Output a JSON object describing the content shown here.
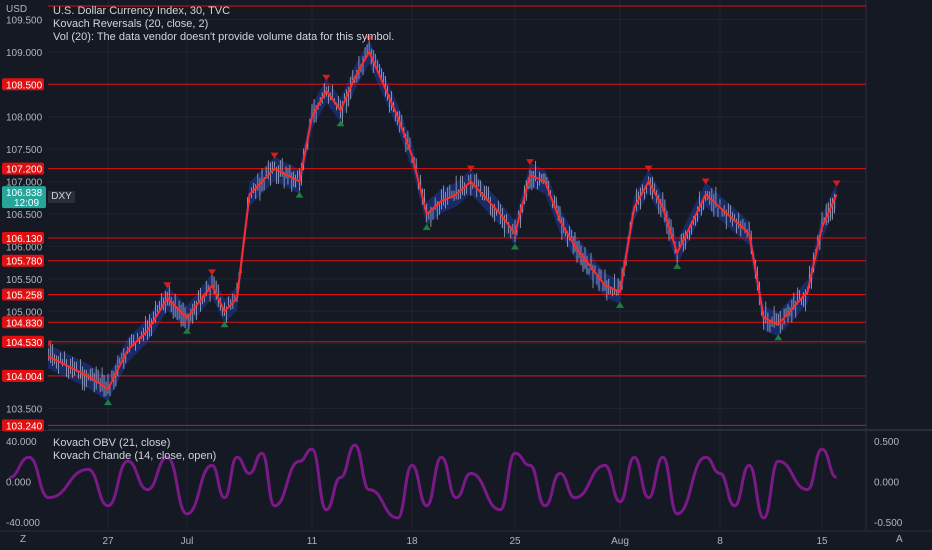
{
  "colors": {
    "background": "#151924",
    "grid": "#1f2431",
    "sr_line": "#e01010",
    "price_line": "#ff2a2a",
    "band": "#1e3a9c",
    "candle": "#d0d4dc",
    "down_marker": "#d61b1b",
    "up_marker": "#19803d",
    "oscillator": "#7a1a86",
    "price_tag": "#26a69a"
  },
  "legend": {
    "line1": "U.S. Dollar Currency Index, 30, TVC",
    "line2": "Kovach Reversals (20, close, 2)",
    "line3": "Vol (20): The data vendor doesn't provide volume data for this symbol."
  },
  "indicator_legend": {
    "line1": "Kovach OBV (21, close)",
    "line2": "Kovach Chande (14, close, open)"
  },
  "corner": {
    "currency": "USD",
    "left_scale_btn": "Z",
    "right_scale_btn": "A"
  },
  "current_price": {
    "value": "106.838",
    "countdown": "12:09",
    "symbol": "DXY"
  },
  "chart_data": [
    {
      "type": "line",
      "title": "U.S. Dollar Currency Index, 30, TVC",
      "ylabel": "USD",
      "ylim": [
        103.2,
        109.8
      ],
      "x_ticks": [
        "27",
        "Jul",
        "11",
        "18",
        "25",
        "Aug",
        "8",
        "15"
      ],
      "y_ticks": [
        "103.500",
        "104.000",
        "104.500",
        "105.000",
        "105.500",
        "106.000",
        "106.500",
        "107.000",
        "107.500",
        "108.000",
        "108.500",
        "109.000",
        "109.500"
      ],
      "levels": [
        "108.500",
        "107.200",
        "106.130",
        "105.780",
        "105.258",
        "104.830",
        "104.530",
        "104.004",
        "103.240"
      ],
      "last_price": 106.838,
      "series": [
        {
          "x": [
            "Jun 22",
            "Jun 23",
            "Jun 24",
            "Jun 26",
            "Jun 27",
            "Jun 28",
            "Jun 29",
            "Jun 30",
            "Jul 1",
            "Jul 3",
            "Jul 4",
            "Jul 5",
            "Jul 6",
            "Jul 7",
            "Jul 8",
            "Jul 10",
            "Jul 11",
            "Jul 12",
            "Jul 13",
            "Jul 14",
            "Jul 15",
            "Jul 17",
            "Jul 18",
            "Jul 19",
            "Jul 20",
            "Jul 21",
            "Jul 22",
            "Jul 24",
            "Jul 25",
            "Jul 26",
            "Jul 27",
            "Jul 28",
            "Jul 29",
            "Jul 31",
            "Aug 1",
            "Aug 2",
            "Aug 3",
            "Aug 4",
            "Aug 5",
            "Aug 7",
            "Aug 8",
            "Aug 9",
            "Aug 10",
            "Aug 11",
            "Aug 12",
            "Aug 14",
            "Aug 15",
            "Aug 16"
          ],
          "y": [
            104.8,
            104.3,
            104.3,
            104.0,
            103.8,
            104.4,
            104.7,
            105.2,
            104.9,
            105.4,
            105.0,
            105.2,
            106.8,
            107.0,
            107.2,
            107.0,
            108.0,
            108.4,
            108.1,
            108.6,
            109.0,
            108.0,
            107.4,
            106.5,
            106.7,
            106.8,
            107.0,
            106.5,
            106.2,
            107.1,
            107.0,
            106.4,
            106.0,
            105.4,
            105.3,
            106.6,
            107.0,
            106.6,
            105.9,
            106.8,
            106.6,
            106.4,
            106.2,
            104.9,
            104.8,
            105.3,
            106.3,
            106.8
          ]
        }
      ]
    },
    {
      "type": "line",
      "title": "Kovach Chande (14, close, open)",
      "ylim": [
        -0.6,
        0.6
      ],
      "y_ticks": [
        "0.500",
        "0.000",
        "-0.500"
      ],
      "y_ticks_left": [
        "40.000",
        "0.000",
        "-40.000"
      ],
      "x_ticks": [
        "27",
        "Jul",
        "11",
        "18",
        "25",
        "Aug",
        "8",
        "15"
      ],
      "series": [
        {
          "x": [
            "Jun 22",
            "Jun 23",
            "Jun 24",
            "Jun 26",
            "Jun 27",
            "Jun 28",
            "Jun 29",
            "Jun 30",
            "Jul 1",
            "Jul 3",
            "Jul 4",
            "Jul 5",
            "Jul 6",
            "Jul 7",
            "Jul 8",
            "Jul 10",
            "Jul 11",
            "Jul 12",
            "Jul 13",
            "Jul 14",
            "Jul 15",
            "Jul 17",
            "Jul 18",
            "Jul 19",
            "Jul 20",
            "Jul 21",
            "Jul 22",
            "Jul 24",
            "Jul 25",
            "Jul 26",
            "Jul 27",
            "Jul 28",
            "Jul 29",
            "Jul 31",
            "Aug 1",
            "Aug 2",
            "Aug 3",
            "Aug 4",
            "Aug 5",
            "Aug 7",
            "Aug 8",
            "Aug 9",
            "Aug 10",
            "Aug 11",
            "Aug 12",
            "Aug 14",
            "Aug 15",
            "Aug 16"
          ],
          "y": [
            0.05,
            0.3,
            -0.2,
            0.15,
            -0.3,
            0.25,
            -0.1,
            0.3,
            -0.4,
            0.2,
            -0.2,
            0.3,
            0.1,
            0.35,
            -0.3,
            0.25,
            0.4,
            -0.35,
            0.05,
            0.45,
            -0.1,
            -0.45,
            0.2,
            -0.3,
            0.3,
            -0.2,
            0.1,
            -0.35,
            0.35,
            0.2,
            -0.3,
            0.1,
            -0.2,
            0.2,
            -0.25,
            0.3,
            -0.2,
            0.3,
            -0.4,
            0.3,
            0.1,
            -0.3,
            0.2,
            -0.45,
            0.25,
            -0.1,
            0.4,
            0.05
          ]
        }
      ]
    }
  ]
}
